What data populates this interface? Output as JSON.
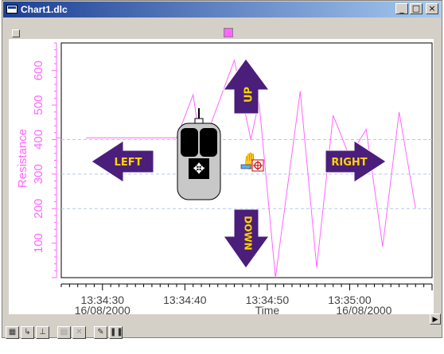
{
  "window": {
    "title": "Chart1.dlc",
    "min_glyph": "_",
    "max_glyph": "□",
    "close_glyph": "×"
  },
  "chart_data": {
    "type": "line",
    "ylabel": "Resistance",
    "xlabel": "Time",
    "ylim": [
      0,
      680
    ],
    "yticks": [
      "100",
      "200",
      "300",
      "400",
      "500",
      "600"
    ],
    "xticks": [
      {
        "time": "13:34:30",
        "date": "16/08/2000"
      },
      {
        "time": "13:34:40",
        "date": ""
      },
      {
        "time": "13:34:50",
        "date": ""
      },
      {
        "time": "13:35:00",
        "date": "16/08/2000"
      }
    ],
    "series_color": "#ff66ff",
    "grid": "dashed horizontal",
    "series": [
      {
        "values": [
          [
            "13:34:28",
            405
          ],
          [
            "13:34:33",
            405
          ],
          [
            "13:34:39",
            405
          ],
          [
            "13:34:41",
            530
          ],
          [
            "13:34:42",
            370
          ],
          [
            "13:34:46",
            630
          ],
          [
            "13:34:48",
            400
          ],
          [
            "13:34:49",
            510
          ],
          [
            "13:34:51",
            0
          ],
          [
            "13:34:54",
            540
          ],
          [
            "13:34:56",
            30
          ],
          [
            "13:34:58",
            470
          ],
          [
            "13:35:00",
            350
          ],
          [
            "13:35:02",
            430
          ],
          [
            "13:35:04",
            90
          ],
          [
            "13:35:06",
            480
          ],
          [
            "13:35:08",
            200
          ]
        ]
      }
    ]
  },
  "overlay": {
    "left_label": "LEFT",
    "right_label": "RIGHT",
    "up_label": "UP",
    "down_label": "DOWN"
  },
  "toolbar": {
    "tools": [
      {
        "name": "tool-chart",
        "glyph": "▦"
      },
      {
        "name": "tool-axis-xy",
        "glyph": "↳"
      },
      {
        "name": "tool-axis",
        "glyph": "⊥"
      },
      {
        "name": "tool-sep",
        "glyph": ""
      },
      {
        "name": "tool-copy",
        "glyph": "▤"
      },
      {
        "name": "tool-delete",
        "glyph": "✕"
      },
      {
        "name": "tool-sep",
        "glyph": ""
      },
      {
        "name": "tool-edit",
        "glyph": "✎"
      },
      {
        "name": "tool-pause",
        "glyph": "❚❚"
      }
    ]
  }
}
